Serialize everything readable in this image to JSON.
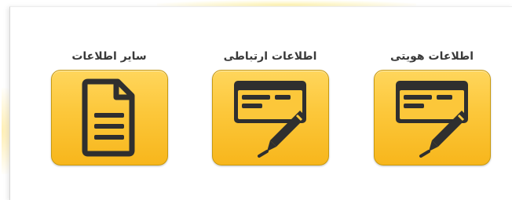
{
  "tiles": [
    {
      "label": "اطلاعات هویتی",
      "icon": "id-card-sign-icon"
    },
    {
      "label": "اطلاعات ارتباطی",
      "icon": "id-card-sign-icon"
    },
    {
      "label": "سایر اطلاعات",
      "icon": "document-icon"
    }
  ],
  "colors": {
    "tile_top": "#ffd65c",
    "tile_bottom": "#f7b61c",
    "tile_border": "#c99a0e",
    "icon": "#2f2f2f",
    "label": "#3a3a3a"
  }
}
